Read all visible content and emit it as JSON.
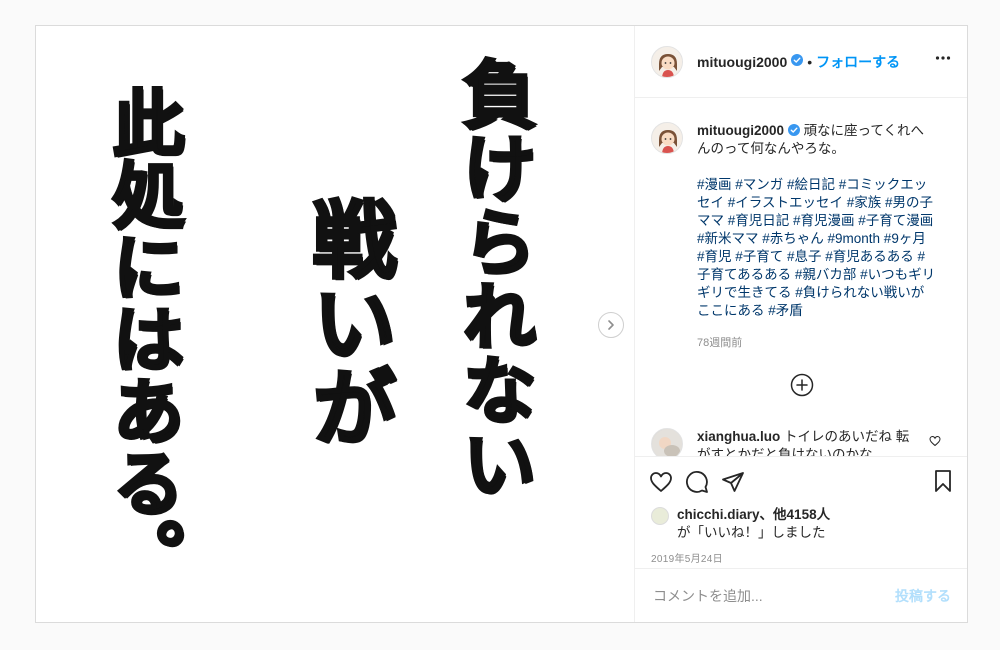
{
  "image": {
    "column1": "負けられない",
    "column2": "戦いが",
    "column3": "此処にはある。"
  },
  "header": {
    "username": "mituougi2000",
    "separator": "•",
    "follow_label": "フォローする"
  },
  "caption": {
    "username": "mituougi2000",
    "text": "頑なに座ってくれへんのって何なんやろな。",
    "hashtags": "#漫画 #マンガ #絵日記 #コミックエッセイ #イラストエッセイ #家族 #男の子ママ #育児日記 #育児漫画 #子育て漫画 #新米ママ #赤ちゃん #9month #9ヶ月 #育児 #子育て #息子 #育児あるある #子育てあるある #親バカ部 #いつもギリギリで生きてる #負けられない戦いがここにある #矛盾",
    "time_ago": "78週間前"
  },
  "comments": [
    {
      "username": "xianghua.luo",
      "text": "トイレのあいだね 転がすとかだと負けないのかな"
    }
  ],
  "likes": {
    "username": "chicchi.diary",
    "others": "、他4158人",
    "suffix": "が「いいね！」しました"
  },
  "date": "2019年5月24日",
  "add_comment": {
    "placeholder": "コメントを追加...",
    "post_label": "投稿する"
  },
  "colors": {
    "accent": "#0095f6",
    "hashtag": "#00376b",
    "verified": "#3897f0",
    "muted": "#8e8e8e"
  }
}
